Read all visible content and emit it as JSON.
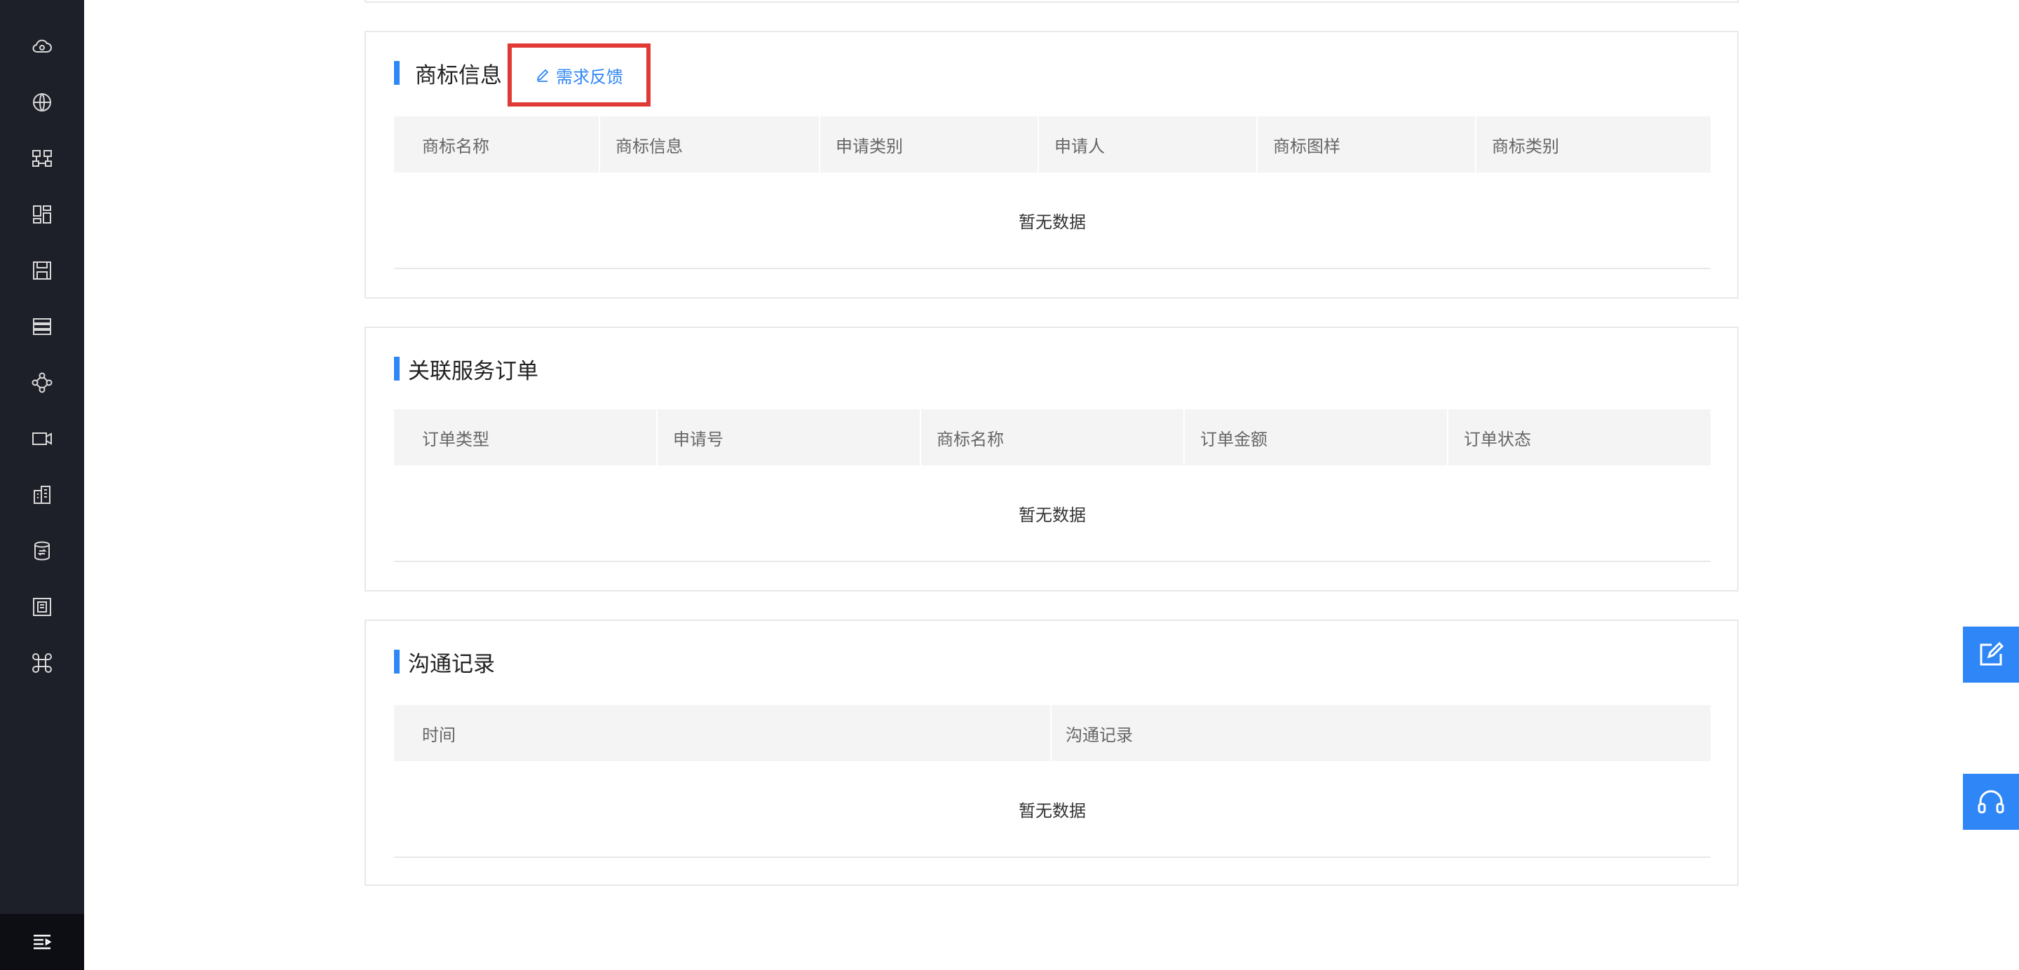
{
  "sidebar": {
    "icons": [
      "cloud-icon",
      "globe-icon",
      "flow-icon",
      "dashboard-icon",
      "save-icon",
      "list-icon",
      "network-icon",
      "video-icon",
      "building-icon",
      "database-icon",
      "frame-icon",
      "command-icon"
    ],
    "bottom_icon": "menu-collapse-icon"
  },
  "trademark": {
    "title": "商标信息",
    "feedback_label": "需求反馈",
    "columns": [
      "商标名称",
      "商标信息",
      "申请类别",
      "申请人",
      "商标图样",
      "商标类别"
    ],
    "empty": "暂无数据"
  },
  "orders": {
    "title": "关联服务订单",
    "columns": [
      "订单类型",
      "申请号",
      "商标名称",
      "订单金额",
      "订单状态"
    ],
    "empty": "暂无数据"
  },
  "communication": {
    "title": "沟通记录",
    "columns": [
      "时间",
      "沟通记录"
    ],
    "empty": "暂无数据"
  },
  "floating": {
    "edit_icon": "edit-icon",
    "support_icon": "headset-icon"
  },
  "colors": {
    "sidebar_bg": "#1e2029",
    "accent": "#2f86f6",
    "highlight": "#e03a36"
  }
}
